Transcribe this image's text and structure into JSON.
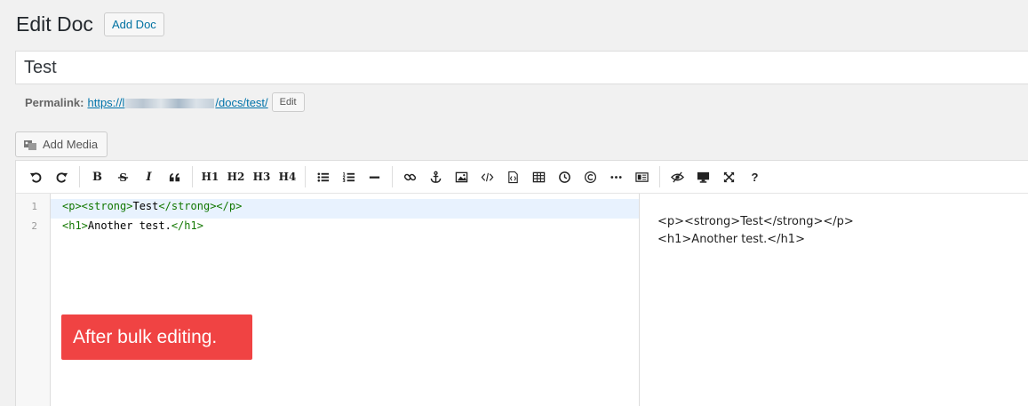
{
  "header": {
    "title": "Edit Doc",
    "add_doc_label": "Add Doc"
  },
  "post_title": "Test",
  "permalink": {
    "label": "Permalink:",
    "url_prefix": "https://l",
    "url_suffix": "/docs/test/",
    "edit_label": "Edit"
  },
  "add_media_label": "Add Media",
  "toolbar": {
    "bold": "B",
    "italic": "I",
    "h1": "H1",
    "h2": "H2",
    "h3": "H3",
    "h4": "H4",
    "help": "?"
  },
  "editor": {
    "line_numbers": [
      "1",
      "2"
    ],
    "lines": [
      {
        "open": "<p><strong>",
        "text": "Test",
        "close": "</strong></p>"
      },
      {
        "open": "<h1>",
        "text": "Another test.",
        "close": "</h1>"
      }
    ]
  },
  "preview": {
    "lines": [
      "<p><strong>Test</strong></p>",
      "<h1>Another test.</h1>"
    ]
  },
  "annotation": "After bulk editing.",
  "colors": {
    "accent": "#0071a1",
    "badge": "#f04343",
    "active_line": "#e8f2fe"
  }
}
